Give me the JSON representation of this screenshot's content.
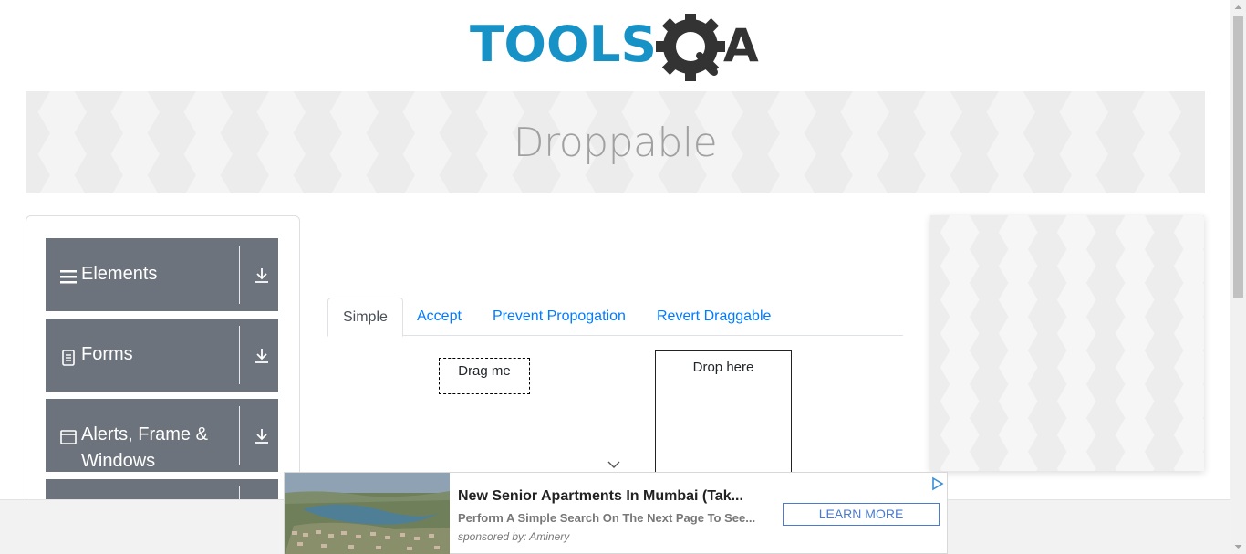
{
  "header": {
    "logo_text_primary": "TOOLS",
    "logo_text_secondary": "QA",
    "brand_color": "#1792c7",
    "logo_dark_color": "#333333"
  },
  "banner": {
    "title": "Droppable"
  },
  "sidebar": {
    "groups": [
      {
        "label": "Elements",
        "icon": "hamburger-icon"
      },
      {
        "label": "Forms",
        "icon": "document-icon"
      },
      {
        "label_line1": "Alerts, Frame &",
        "label_line2": "Windows",
        "icon": "window-icon"
      },
      {
        "label": "",
        "icon": ""
      }
    ],
    "group_color": "#6c737c"
  },
  "tabs": {
    "items": [
      "Simple",
      "Accept",
      "Prevent Propogation",
      "Revert Draggable"
    ],
    "active": "Simple",
    "link_color": "#007bff"
  },
  "dragdrop": {
    "drag_label": "Drag me",
    "drop_label": "Drop here"
  },
  "ad": {
    "title": "New Senior Apartments In Mumbai (Tak...",
    "description": "Perform A Simple Search On The Next Page To See...",
    "sponsor": "sponsored by: Aminery",
    "cta": "LEARN MORE",
    "cta_color": "#4a7bd0"
  }
}
